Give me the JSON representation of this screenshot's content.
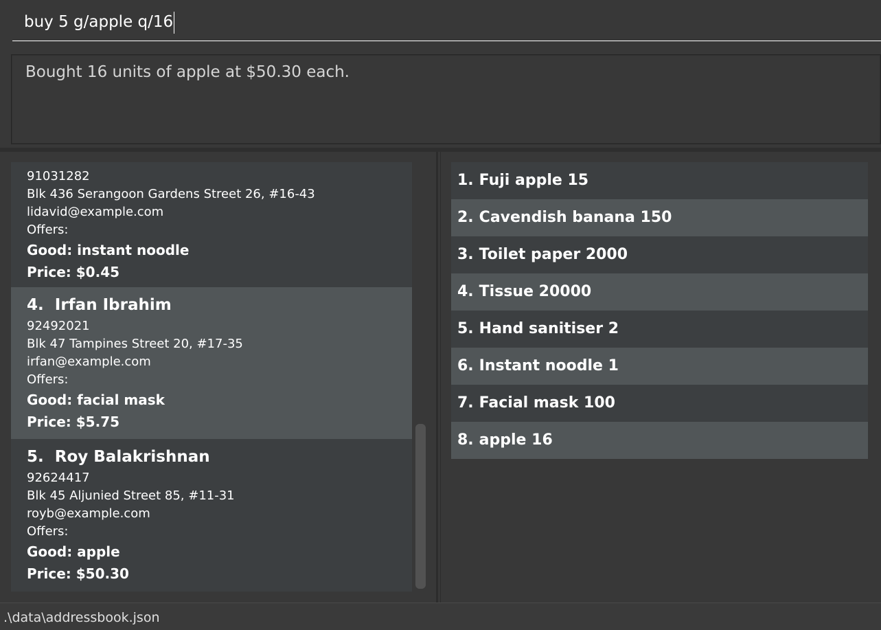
{
  "command": {
    "value": "buy 5 g/apple q/16"
  },
  "result": {
    "message": "Bought 16 units of apple at $50.30 each."
  },
  "persons": [
    {
      "phone": "91031282",
      "address": "Blk 436 Serangoon Gardens Street 26, #16-43",
      "email": "lidavid@example.com",
      "offers_label": "Offers:",
      "good": "Good: instant noodle",
      "price": "Price: $0.45"
    },
    {
      "index": "4.",
      "name": "Irfan Ibrahim",
      "phone": "92492021",
      "address": "Blk 47 Tampines Street 20, #17-35",
      "email": "irfan@example.com",
      "offers_label": "Offers:",
      "good": "Good: facial mask",
      "price": "Price: $5.75"
    },
    {
      "index": "5.",
      "name": "Roy Balakrishnan",
      "phone": "92624417",
      "address": "Blk 45 Aljunied Street 85, #11-31",
      "email": "royb@example.com",
      "offers_label": "Offers:",
      "good": "Good: apple",
      "price": "Price: $50.30"
    }
  ],
  "goods": [
    {
      "index": "1.",
      "text": "Fuji apple 15"
    },
    {
      "index": "2.",
      "text": "Cavendish banana 150"
    },
    {
      "index": "3.",
      "text": "Toilet paper 2000"
    },
    {
      "index": "4.",
      "text": "Tissue 20000"
    },
    {
      "index": "5.",
      "text": "Hand sanitiser 2"
    },
    {
      "index": "6.",
      "text": "Instant noodle 1"
    },
    {
      "index": "7.",
      "text": "Facial mask 100"
    },
    {
      "index": "8.",
      "text": "apple 16"
    }
  ],
  "status": {
    "path": ".\\data\\addressbook.json"
  },
  "colors": {
    "background": "#383838",
    "card_dark": "#3c3f41",
    "card_light": "#515658",
    "text": "#ffffff"
  }
}
